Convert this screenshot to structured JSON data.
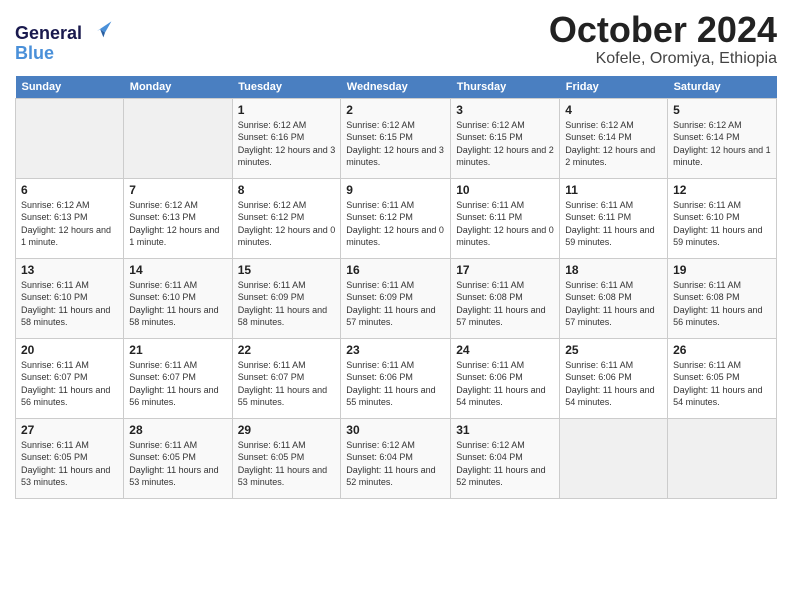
{
  "header": {
    "logo_line1": "General",
    "logo_line2": "Blue",
    "month": "October 2024",
    "location": "Kofele, Oromiya, Ethiopia"
  },
  "weekdays": [
    "Sunday",
    "Monday",
    "Tuesday",
    "Wednesday",
    "Thursday",
    "Friday",
    "Saturday"
  ],
  "weeks": [
    [
      {
        "day": "",
        "info": ""
      },
      {
        "day": "",
        "info": ""
      },
      {
        "day": "1",
        "info": "Sunrise: 6:12 AM\nSunset: 6:16 PM\nDaylight: 12 hours and 3 minutes."
      },
      {
        "day": "2",
        "info": "Sunrise: 6:12 AM\nSunset: 6:15 PM\nDaylight: 12 hours and 3 minutes."
      },
      {
        "day": "3",
        "info": "Sunrise: 6:12 AM\nSunset: 6:15 PM\nDaylight: 12 hours and 2 minutes."
      },
      {
        "day": "4",
        "info": "Sunrise: 6:12 AM\nSunset: 6:14 PM\nDaylight: 12 hours and 2 minutes."
      },
      {
        "day": "5",
        "info": "Sunrise: 6:12 AM\nSunset: 6:14 PM\nDaylight: 12 hours and 1 minute."
      }
    ],
    [
      {
        "day": "6",
        "info": "Sunrise: 6:12 AM\nSunset: 6:13 PM\nDaylight: 12 hours and 1 minute."
      },
      {
        "day": "7",
        "info": "Sunrise: 6:12 AM\nSunset: 6:13 PM\nDaylight: 12 hours and 1 minute."
      },
      {
        "day": "8",
        "info": "Sunrise: 6:12 AM\nSunset: 6:12 PM\nDaylight: 12 hours and 0 minutes."
      },
      {
        "day": "9",
        "info": "Sunrise: 6:11 AM\nSunset: 6:12 PM\nDaylight: 12 hours and 0 minutes."
      },
      {
        "day": "10",
        "info": "Sunrise: 6:11 AM\nSunset: 6:11 PM\nDaylight: 12 hours and 0 minutes."
      },
      {
        "day": "11",
        "info": "Sunrise: 6:11 AM\nSunset: 6:11 PM\nDaylight: 11 hours and 59 minutes."
      },
      {
        "day": "12",
        "info": "Sunrise: 6:11 AM\nSunset: 6:10 PM\nDaylight: 11 hours and 59 minutes."
      }
    ],
    [
      {
        "day": "13",
        "info": "Sunrise: 6:11 AM\nSunset: 6:10 PM\nDaylight: 11 hours and 58 minutes."
      },
      {
        "day": "14",
        "info": "Sunrise: 6:11 AM\nSunset: 6:10 PM\nDaylight: 11 hours and 58 minutes."
      },
      {
        "day": "15",
        "info": "Sunrise: 6:11 AM\nSunset: 6:09 PM\nDaylight: 11 hours and 58 minutes."
      },
      {
        "day": "16",
        "info": "Sunrise: 6:11 AM\nSunset: 6:09 PM\nDaylight: 11 hours and 57 minutes."
      },
      {
        "day": "17",
        "info": "Sunrise: 6:11 AM\nSunset: 6:08 PM\nDaylight: 11 hours and 57 minutes."
      },
      {
        "day": "18",
        "info": "Sunrise: 6:11 AM\nSunset: 6:08 PM\nDaylight: 11 hours and 57 minutes."
      },
      {
        "day": "19",
        "info": "Sunrise: 6:11 AM\nSunset: 6:08 PM\nDaylight: 11 hours and 56 minutes."
      }
    ],
    [
      {
        "day": "20",
        "info": "Sunrise: 6:11 AM\nSunset: 6:07 PM\nDaylight: 11 hours and 56 minutes."
      },
      {
        "day": "21",
        "info": "Sunrise: 6:11 AM\nSunset: 6:07 PM\nDaylight: 11 hours and 56 minutes."
      },
      {
        "day": "22",
        "info": "Sunrise: 6:11 AM\nSunset: 6:07 PM\nDaylight: 11 hours and 55 minutes."
      },
      {
        "day": "23",
        "info": "Sunrise: 6:11 AM\nSunset: 6:06 PM\nDaylight: 11 hours and 55 minutes."
      },
      {
        "day": "24",
        "info": "Sunrise: 6:11 AM\nSunset: 6:06 PM\nDaylight: 11 hours and 54 minutes."
      },
      {
        "day": "25",
        "info": "Sunrise: 6:11 AM\nSunset: 6:06 PM\nDaylight: 11 hours and 54 minutes."
      },
      {
        "day": "26",
        "info": "Sunrise: 6:11 AM\nSunset: 6:05 PM\nDaylight: 11 hours and 54 minutes."
      }
    ],
    [
      {
        "day": "27",
        "info": "Sunrise: 6:11 AM\nSunset: 6:05 PM\nDaylight: 11 hours and 53 minutes."
      },
      {
        "day": "28",
        "info": "Sunrise: 6:11 AM\nSunset: 6:05 PM\nDaylight: 11 hours and 53 minutes."
      },
      {
        "day": "29",
        "info": "Sunrise: 6:11 AM\nSunset: 6:05 PM\nDaylight: 11 hours and 53 minutes."
      },
      {
        "day": "30",
        "info": "Sunrise: 6:12 AM\nSunset: 6:04 PM\nDaylight: 11 hours and 52 minutes."
      },
      {
        "day": "31",
        "info": "Sunrise: 6:12 AM\nSunset: 6:04 PM\nDaylight: 11 hours and 52 minutes."
      },
      {
        "day": "",
        "info": ""
      },
      {
        "day": "",
        "info": ""
      }
    ]
  ]
}
